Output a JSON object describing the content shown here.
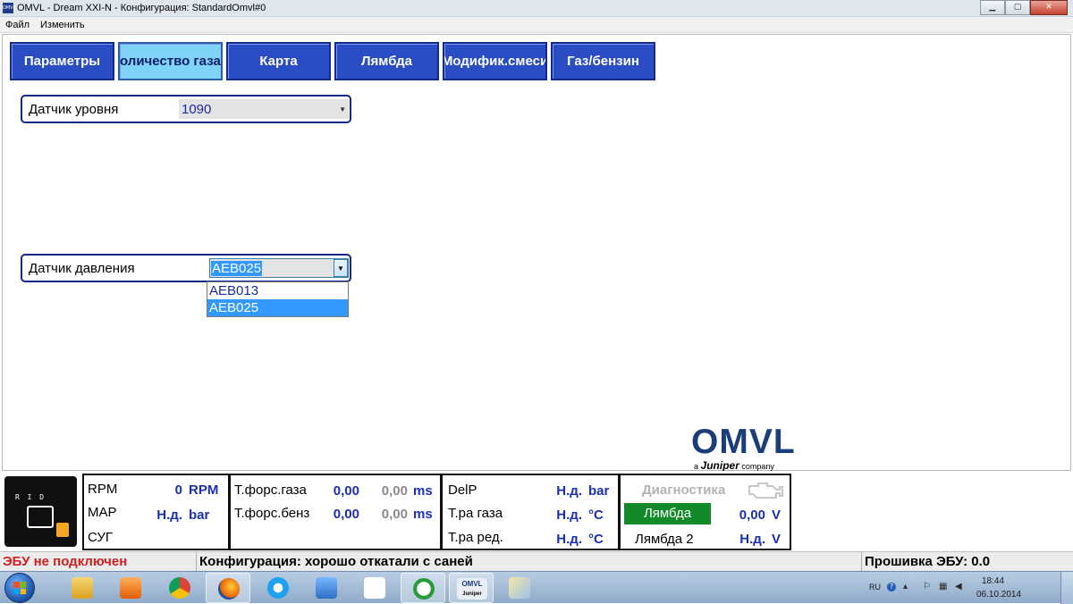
{
  "window": {
    "icon_text": "OMVL",
    "title": "OMVL - Dream XXI-N - Конфигурация: StandardOmvl#0",
    "controls": {
      "minimize": "▁",
      "maximize": "▢",
      "close": "✕"
    }
  },
  "menu": {
    "items": [
      "Файл",
      "Изменить"
    ]
  },
  "tabs": [
    {
      "label": "Параметры",
      "active": false
    },
    {
      "label": "оличество газа",
      "active": true
    },
    {
      "label": "Карта",
      "active": false
    },
    {
      "label": "Лямбда",
      "active": false
    },
    {
      "label": "Модифик.смеси",
      "active": false
    },
    {
      "label": "Газ/бензин",
      "active": false
    }
  ],
  "level_sensor": {
    "label": "Датчик уровня",
    "value": "1090",
    "arrow": "▼"
  },
  "pressure_sensor": {
    "label": "Датчик давления",
    "value": "AEB025",
    "arrow": "▼",
    "options": [
      "AEB013",
      "AEB025"
    ],
    "selected_option": "AEB025"
  },
  "logo": {
    "main": "OMVL",
    "sub_prefix": "a",
    "sub_brand": "Juniper",
    "sub_suffix": "company"
  },
  "ecu": {
    "label": "R I D"
  },
  "dashboard": {
    "panel1": {
      "rpm_label": "RPM",
      "rpm_value": "0",
      "rpm_unit": "RPM",
      "map_label": "MAP",
      "map_value": "Н.д.",
      "map_unit": "bar",
      "sug_label": "СУГ"
    },
    "panel2": {
      "gas_inj_label": "Т.форс.газа",
      "gas_inj_value": "0,00",
      "gas_inj_value2": "0,00",
      "gas_inj_unit": "ms",
      "petrol_inj_label": "Т.форс.бенз",
      "petrol_inj_value": "0,00",
      "petrol_inj_value2": "0,00",
      "petrol_inj_unit": "ms"
    },
    "panel3": {
      "delp_label": "DelP",
      "delp_value": "Н.д.",
      "delp_unit": "bar",
      "gas_temp_label": "Т.ра газа",
      "gas_temp_value": "Н.д.",
      "gas_temp_unit": "°C",
      "red_temp_label": "Т.ра ред.",
      "red_temp_value": "Н.д.",
      "red_temp_unit": "°C"
    },
    "panel4": {
      "diag_label": "Диагностика",
      "lambda_label": "Лямбда",
      "lambda_value": "0,00",
      "lambda_unit": "V",
      "lambda2_label": "Лямбда 2",
      "lambda2_value": "Н.д.",
      "lambda2_unit": "V"
    }
  },
  "statusbar": {
    "ecu_status": "ЭБУ не подключен",
    "config": "Конфигурация: хорошо откатали с саней",
    "firmware": "Прошивка ЭБУ: 0.0"
  },
  "taskbar": {
    "apps": [
      "explorer",
      "media-player",
      "chrome",
      "firefox",
      "internet-explorer",
      "speaker-app",
      "yandex-browser",
      "monitor-app",
      "omvl",
      "paint"
    ],
    "omvl_label_1": "OMVL",
    "omvl_label_2": "Juniper",
    "lang": "RU",
    "time": "18:44",
    "date": "06.10.2014"
  },
  "colors": {
    "tab_blue": "#2b4dc3",
    "tab_active": "#7fd3f5",
    "value_blue": "#1b2fb5",
    "status_red": "#d01f1f",
    "lambda_green": "#138a2a"
  }
}
